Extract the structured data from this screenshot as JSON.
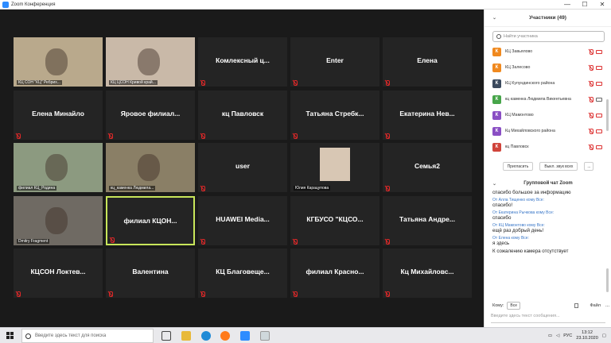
{
  "window": {
    "title": "Zoom Конференция",
    "controls": [
      "—",
      "☐",
      "✕"
    ]
  },
  "gallery": {
    "tiles": [
      {
        "name": "",
        "video": true,
        "label": "КЦ СОН \"КЦ\" Ребрих...",
        "bg": "#b9a98c",
        "row": 0,
        "col": 0
      },
      {
        "name": "",
        "video": true,
        "label": "КЦ ЦСОН Кривой край...",
        "bg": "#c9b9a8",
        "row": 0,
        "col": 1
      },
      {
        "name": "Комлексный ц...",
        "video": false,
        "label": "",
        "row": 0,
        "col": 2
      },
      {
        "name": "Enter",
        "video": false,
        "label": "",
        "row": 0,
        "col": 3
      },
      {
        "name": "Елена",
        "video": false,
        "label": "",
        "row": 0,
        "col": 4
      },
      {
        "name": "Елена Минайло",
        "video": false,
        "label": "",
        "row": 1,
        "col": 0
      },
      {
        "name": "Яровое филиал...",
        "video": false,
        "label": "",
        "row": 1,
        "col": 1
      },
      {
        "name": "кц Павловск",
        "video": false,
        "label": "",
        "row": 1,
        "col": 2
      },
      {
        "name": "Татьяна Стребк...",
        "video": false,
        "label": "",
        "row": 1,
        "col": 3
      },
      {
        "name": "Екатерина Нев...",
        "video": false,
        "label": "",
        "row": 1,
        "col": 4
      },
      {
        "name": "",
        "video": true,
        "label": "филиал КЦ_Родина",
        "bg": "#8c9a80",
        "row": 2,
        "col": 0
      },
      {
        "name": "",
        "video": true,
        "label": "кц_каменка Людмила...",
        "bg": "#8a7f66",
        "row": 2,
        "col": 1
      },
      {
        "name": "user",
        "video": false,
        "label": "",
        "row": 2,
        "col": 2
      },
      {
        "name": "",
        "video": true,
        "label": "Юлия Карацупова",
        "bg": "#242424",
        "row": 2,
        "col": 3
      },
      {
        "name": "Семья2",
        "video": false,
        "label": "",
        "row": 2,
        "col": 4
      },
      {
        "name": "",
        "video": true,
        "label": "Dmitry Fragment",
        "bg": "#6f6a63",
        "row": 3,
        "col": 0
      },
      {
        "name": "филиал КЦОН...",
        "video": false,
        "label": "",
        "active": true,
        "row": 3,
        "col": 1
      },
      {
        "name": "HUAWEI Media...",
        "video": false,
        "label": "",
        "row": 3,
        "col": 2
      },
      {
        "name": "КГБУСО \"КЦСО...",
        "video": false,
        "label": "",
        "row": 3,
        "col": 3
      },
      {
        "name": "Татьяна Андре...",
        "video": false,
        "label": "",
        "row": 3,
        "col": 4
      },
      {
        "name": "КЦСОН Локтев...",
        "video": false,
        "label": "",
        "row": 4,
        "col": 0
      },
      {
        "name": "Валентина",
        "video": false,
        "label": "",
        "row": 4,
        "col": 1
      },
      {
        "name": "КЦ Благовеще...",
        "video": false,
        "label": "",
        "row": 4,
        "col": 2
      },
      {
        "name": "филиал Красно...",
        "video": false,
        "label": "",
        "row": 4,
        "col": 3
      },
      {
        "name": "Кц Михайловс...",
        "video": false,
        "label": "",
        "row": 4,
        "col": 4
      }
    ]
  },
  "participants": {
    "title": "Участники (49)",
    "search_placeholder": "Найти участника",
    "items": [
      {
        "initial": "К",
        "name": "КЦ Завьялово",
        "color": "#f0891f",
        "cam": "off"
      },
      {
        "initial": "К",
        "name": "КЦ Залесово",
        "color": "#f0891f",
        "cam": "off"
      },
      {
        "initial": "К",
        "name": "КЦ Кулундинского района",
        "color": "#3b4a5e",
        "cam": "off"
      },
      {
        "initial": "К",
        "name": "кц каменка Людмила Викентьевна",
        "color": "#47a54a",
        "cam": "on"
      },
      {
        "initial": "К",
        "name": "КЦ Мамонтово",
        "color": "#8a4fc4",
        "cam": "off"
      },
      {
        "initial": "К",
        "name": "Кц Михайловского района",
        "color": "#8a4fc4",
        "cam": "off"
      },
      {
        "initial": "К",
        "name": "кц Павловск",
        "color": "#d0443b",
        "cam": "off"
      }
    ],
    "invite_label": "Пригласить",
    "mute_all_label": "Выкл. звук всех",
    "more_label": "..."
  },
  "chat": {
    "title": "Групповой чат Zoom",
    "messages": [
      {
        "from": "",
        "text": "спасибо большое за информацию"
      },
      {
        "from": "От Алла Тищенко кому Все:",
        "text": "спасибо!"
      },
      {
        "from": "От Екатерина Рычкова кому Все:",
        "text": "спасибо"
      },
      {
        "from": "От КЦ Мамонтово кому Все:",
        "text": "ещё раз добрый день!"
      },
      {
        "from": "От Елена кому Все:",
        "text": "я здесь"
      },
      {
        "from": "",
        "text": "К сожалению камера отсутствует"
      }
    ],
    "to_label": "Кому:",
    "to_value": "Все",
    "file_label": "Файл",
    "more_label": "...",
    "input_placeholder": "Введите здесь текст сообщения..."
  },
  "taskbar": {
    "search_placeholder": "Введите здесь текст для поиска",
    "lang": "РУС",
    "time": "13:12",
    "date": "23.10.2020"
  }
}
